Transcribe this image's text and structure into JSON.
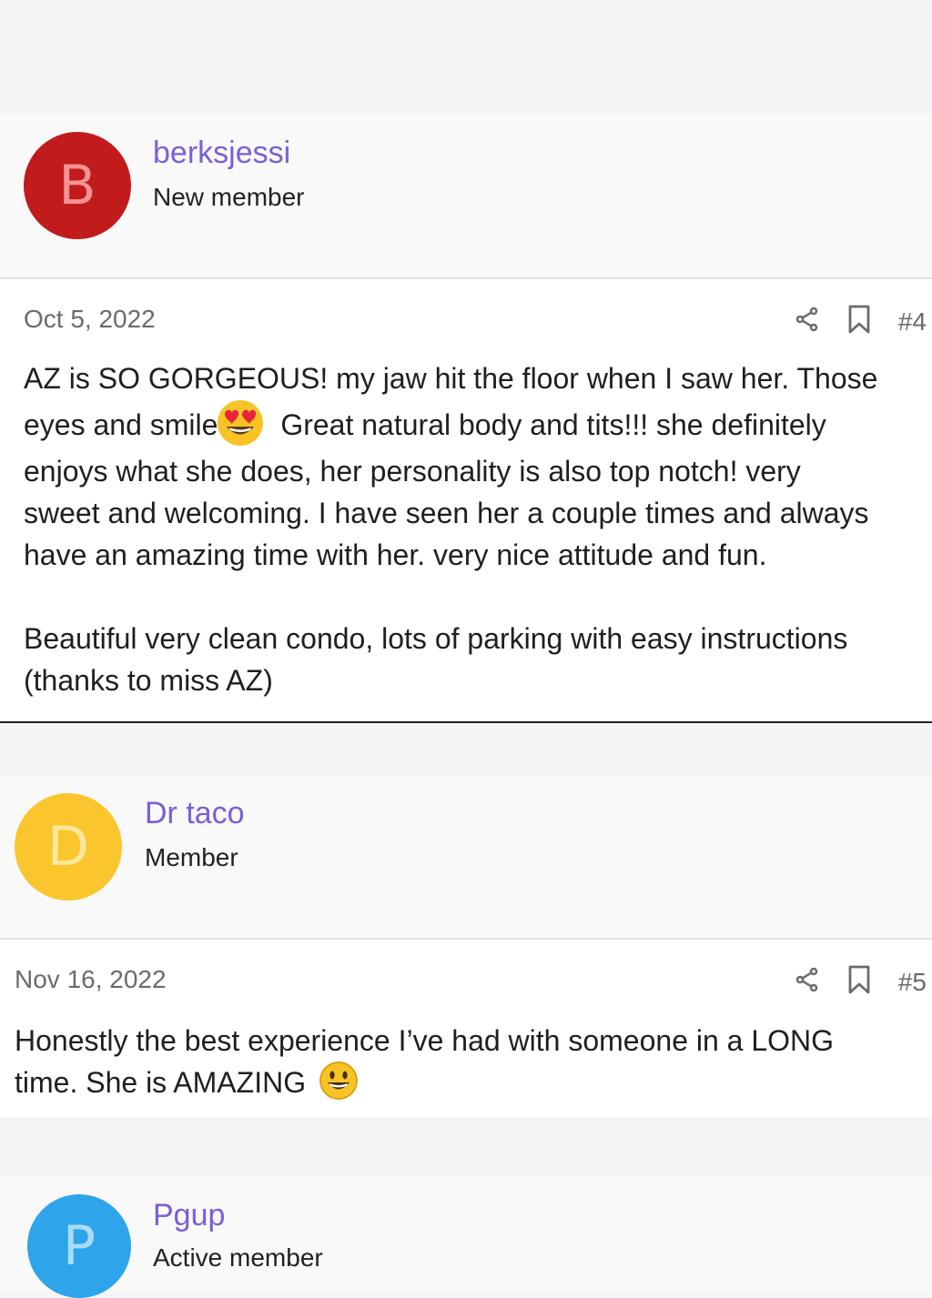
{
  "posts": [
    {
      "username": "berksjessi",
      "user_title": "New member",
      "avatar_letter": "B",
      "avatar_color": "#c11b1b",
      "avatar_letter_color": "#f59393",
      "date": "Oct 5, 2022",
      "post_number": "#4",
      "body_lines": [
        "AZ is SO GORGEOUS! my jaw hit the floor when I saw her. Those",
        "eyes and smile",
        "Great natural body and tits!!! she definitely",
        "enjoys what she does, her personality is also top notch! very",
        "sweet and welcoming. I have seen her a couple times and always",
        "have an amazing time with her. very nice attitude and fun."
      ],
      "body_paragraph2": [
        "Beautiful very clean condo, lots of parking with easy instructions",
        "(thanks to miss AZ)"
      ],
      "emoji": "heart-eyes-emoji"
    },
    {
      "username": "Dr taco",
      "user_title": "Member",
      "avatar_letter": "D",
      "avatar_color": "#fbc52d",
      "avatar_letter_color": "#fde89c",
      "date": "Nov 16, 2022",
      "post_number": "#5",
      "body_lines": [
        "Honestly the best experience I’ve had with someone in a LONG",
        "time. She is AMAZING"
      ],
      "emoji": "grinning-face-emoji"
    },
    {
      "username": "Pgup",
      "user_title": "Active member",
      "avatar_letter": "P",
      "avatar_color": "#2ea5ea",
      "avatar_letter_color": "#a9dcf8"
    }
  ],
  "colors": {
    "username": "#7a5fd6",
    "background": "#f5f5f7",
    "message_bg": "#ffffff"
  },
  "icons": [
    "share-icon",
    "bookmark-icon"
  ]
}
